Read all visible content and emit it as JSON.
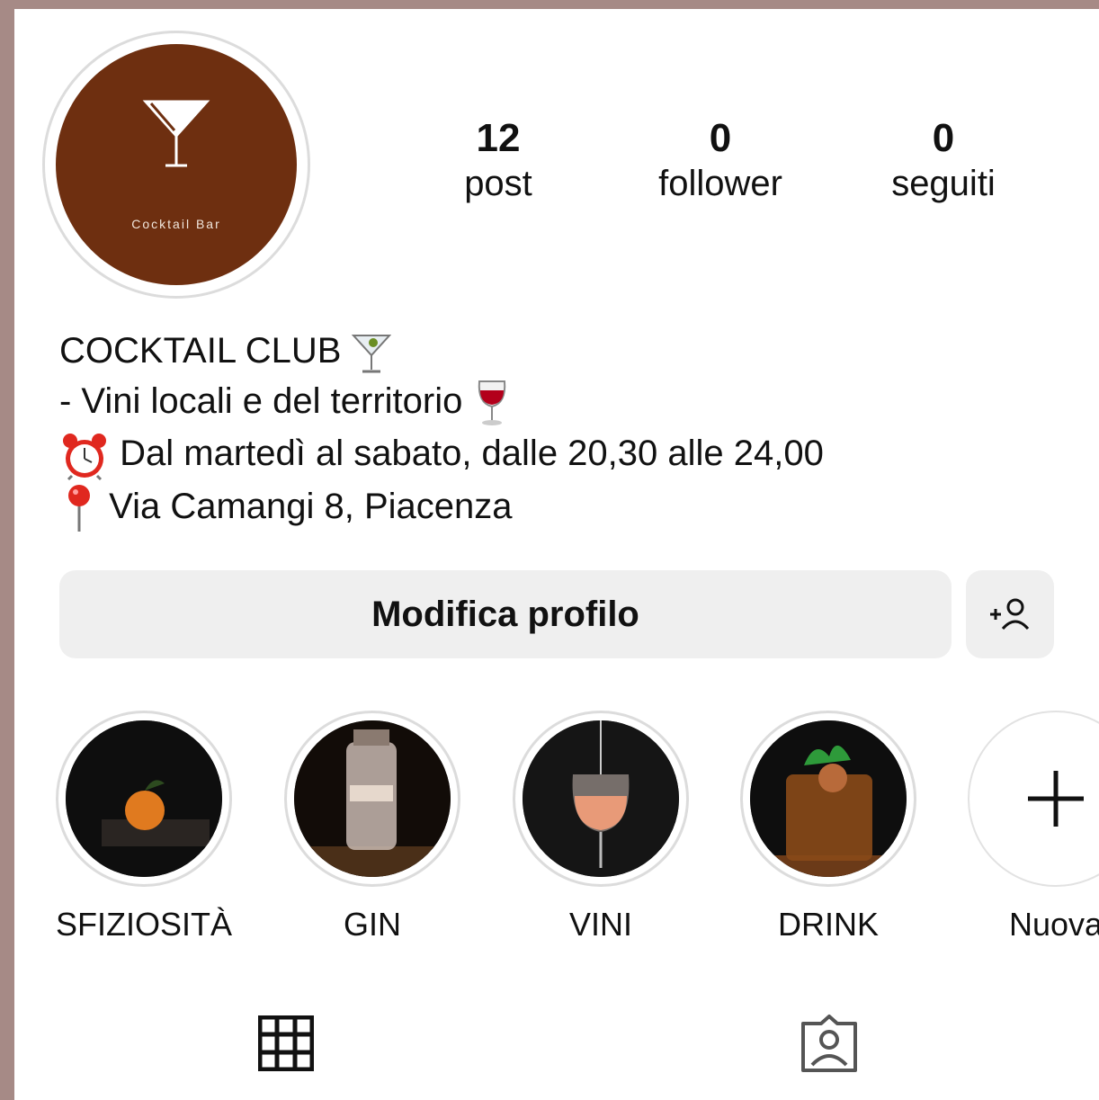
{
  "profile": {
    "avatar_caption": "Cocktail Bar",
    "stats": [
      {
        "value": "12",
        "label": "post"
      },
      {
        "value": "0",
        "label": "follower"
      },
      {
        "value": "0",
        "label": "seguiti"
      }
    ],
    "bio": [
      {
        "text": "COCKTAIL CLUB",
        "emoji": "cocktail-glass-icon"
      },
      {
        "text": "- Vini locali e del territorio",
        "emoji": "wine-glass-icon"
      },
      {
        "text": "Dal martedì al sabato, dalle 20,30 alle 24,00",
        "emoji": "alarm-clock-icon"
      },
      {
        "text": "Via Camangi 8, Piacenza",
        "emoji": "round-pushpin-icon"
      }
    ]
  },
  "actions": {
    "edit_label": "Modifica profilo",
    "add_person_icon": "add-person-icon"
  },
  "highlights": [
    {
      "label": "SFIZIOSITÀ",
      "image": "mandarin-on-tray"
    },
    {
      "label": "GIN",
      "image": "gin-bottle"
    },
    {
      "label": "VINI",
      "image": "wine-glass-pour"
    },
    {
      "label": "DRINK",
      "image": "cocktail-tumbler"
    },
    {
      "label": "Nuova",
      "icon": "plus-icon"
    }
  ],
  "tabs": [
    {
      "icon": "grid-icon"
    },
    {
      "icon": "tagged-person-icon"
    }
  ],
  "colors": {
    "outer_background": "#a68a86",
    "avatar_background": "#6e2f10",
    "button_background": "#efefef"
  }
}
